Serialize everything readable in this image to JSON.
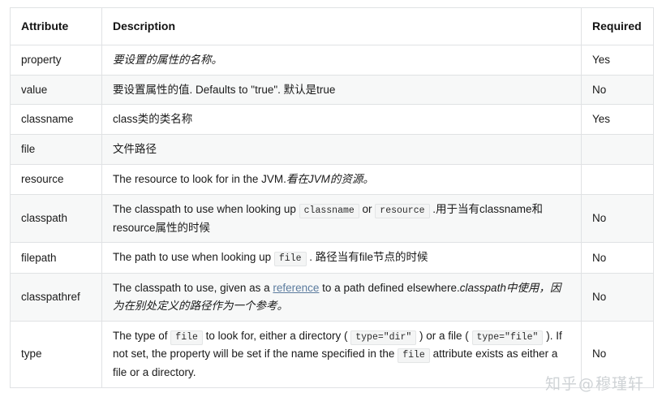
{
  "table": {
    "headers": [
      "Attribute",
      "Description",
      "Required"
    ],
    "rows": [
      {
        "attribute": "property",
        "required": "Yes",
        "description_plain": "要设置的属性的名称。",
        "parts": [
          {
            "kind": "italic",
            "text": "要设置的属性的名称。"
          }
        ]
      },
      {
        "attribute": "value",
        "required": "No",
        "description_plain": "要设置属性的值. Defaults to \"true\". 默认是true",
        "parts": [
          {
            "kind": "text",
            "text": "要设置属性的值. Defaults to \"true\". 默认是true"
          }
        ]
      },
      {
        "attribute": "classname",
        "required": "Yes",
        "description_plain": "class类的类名称",
        "parts": [
          {
            "kind": "text",
            "text": "class类的类名称"
          }
        ]
      },
      {
        "attribute": "file",
        "required": "",
        "description_plain": "文件路径",
        "parts": [
          {
            "kind": "text",
            "text": "文件路径"
          }
        ]
      },
      {
        "attribute": "resource",
        "required": "",
        "description_plain": "The resource to look for in the JVM.看在JVM的资源。",
        "parts": [
          {
            "kind": "text",
            "text": "The resource to look for in the JVM."
          },
          {
            "kind": "italic",
            "text": "看在JVM的资源。"
          }
        ]
      },
      {
        "attribute": "classpath",
        "required": "No",
        "description_plain": "The classpath to use when looking up classname or resource .用于当有classname和resource属性的时候",
        "parts": [
          {
            "kind": "text",
            "text": "The classpath to use when looking up "
          },
          {
            "kind": "code",
            "text": "classname"
          },
          {
            "kind": "text",
            "text": " or "
          },
          {
            "kind": "code",
            "text": "resource"
          },
          {
            "kind": "text",
            "text": " .用于当有classname和resource属性的时候"
          }
        ]
      },
      {
        "attribute": "filepath",
        "required": "No",
        "description_plain": "The path to use when looking up file . 路径当有file节点的时候",
        "parts": [
          {
            "kind": "text",
            "text": "The path to use when looking up "
          },
          {
            "kind": "code",
            "text": "file"
          },
          {
            "kind": "text",
            "text": " . 路径当有file节点的时候"
          }
        ]
      },
      {
        "attribute": "classpathref",
        "required": "No",
        "description_plain": "The classpath to use, given as a reference to a path defined elsewhere.classpath中使用，因为在别处定义的路径作为一个参考。",
        "parts": [
          {
            "kind": "text",
            "text": "The classpath to use, given as a "
          },
          {
            "kind": "link",
            "text": "reference"
          },
          {
            "kind": "text",
            "text": " to a path defined elsewhere."
          },
          {
            "kind": "italic",
            "text": "classpath中使用，因为在别处定义的路径作为一个参考。"
          }
        ]
      },
      {
        "attribute": "type",
        "required": "No",
        "description_plain": "The type of file to look for, either a directory ( type=\"dir\" ) or a file ( type=\"file\" ). If not set, the property will be set if the name specified in the file attribute exists as either a file or a directory.",
        "parts": [
          {
            "kind": "text",
            "text": "The type of "
          },
          {
            "kind": "code",
            "text": "file"
          },
          {
            "kind": "text",
            "text": " to look for, either a directory ( "
          },
          {
            "kind": "code",
            "text": "type=\"dir\""
          },
          {
            "kind": "text",
            "text": " ) or a file ( "
          },
          {
            "kind": "code",
            "text": "type=\"file\""
          },
          {
            "kind": "text",
            "text": " ). If not set, the property will be set if the name specified in the "
          },
          {
            "kind": "code",
            "text": "file"
          },
          {
            "kind": "text",
            "text": " attribute exists as either a file or a directory."
          }
        ]
      }
    ]
  },
  "watermark": {
    "site": "知乎",
    "at": "@",
    "user": "穆瑾轩"
  },
  "colors": {
    "border": "#e0e2e4",
    "alt_row": "#f7f8f8",
    "text": "#1f1f1f",
    "link": "#5b7b9e",
    "code_bg": "#f4f5f5",
    "watermark": "#cfd3d6"
  }
}
